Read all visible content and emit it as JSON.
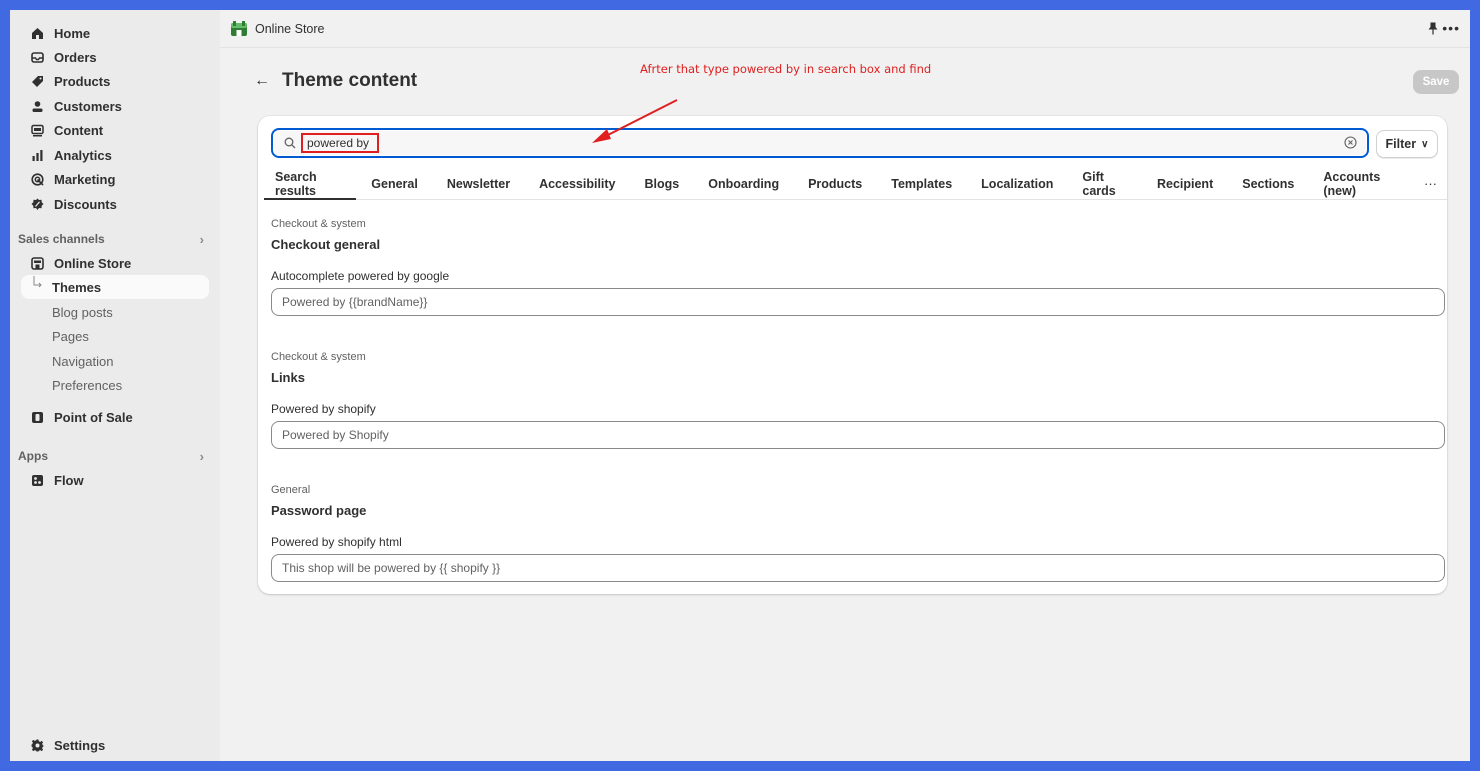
{
  "sidebar": {
    "items": [
      {
        "label": "Home",
        "icon": "home-icon"
      },
      {
        "label": "Orders",
        "icon": "inbox-icon"
      },
      {
        "label": "Products",
        "icon": "tag-icon"
      },
      {
        "label": "Customers",
        "icon": "person-icon"
      },
      {
        "label": "Content",
        "icon": "content-icon"
      },
      {
        "label": "Analytics",
        "icon": "bar-chart-icon"
      },
      {
        "label": "Marketing",
        "icon": "target-icon"
      },
      {
        "label": "Discounts",
        "icon": "discount-icon"
      }
    ],
    "sales_channels": {
      "heading": "Sales channels",
      "online_store": "Online Store",
      "sub_items": [
        "Themes",
        "Blog posts",
        "Pages",
        "Navigation",
        "Preferences"
      ],
      "point_of_sale": "Point of Sale"
    },
    "apps": {
      "heading": "Apps",
      "flow": "Flow"
    },
    "settings": "Settings"
  },
  "topbar": {
    "store_name": "Online Store"
  },
  "page": {
    "title": "Theme content",
    "save_label": "Save",
    "annotation": "Afrter that type powered by in search box and find"
  },
  "search": {
    "value": "powered by",
    "filter_label": "Filter"
  },
  "tabs": [
    "Search results",
    "General",
    "Newsletter",
    "Accessibility",
    "Blogs",
    "Onboarding",
    "Products",
    "Templates",
    "Localization",
    "Gift cards",
    "Recipient",
    "Sections",
    "Accounts (new)"
  ],
  "results": [
    {
      "crumb": "Checkout & system",
      "group": "Checkout general",
      "field_label": "Autocomplete powered by google",
      "field_value": "Powered by {{brandName}}"
    },
    {
      "crumb": "Checkout & system",
      "group": "Links",
      "field_label": "Powered by shopify",
      "field_value": "Powered by Shopify"
    },
    {
      "crumb": "General",
      "group": "Password page",
      "field_label": "Powered by shopify html",
      "field_value": "This shop will be powered by {{ shopify }}"
    }
  ],
  "colors": {
    "accent_focus": "#005bd3",
    "annotation_red": "#e02020",
    "frame_blue": "#4169e1"
  }
}
